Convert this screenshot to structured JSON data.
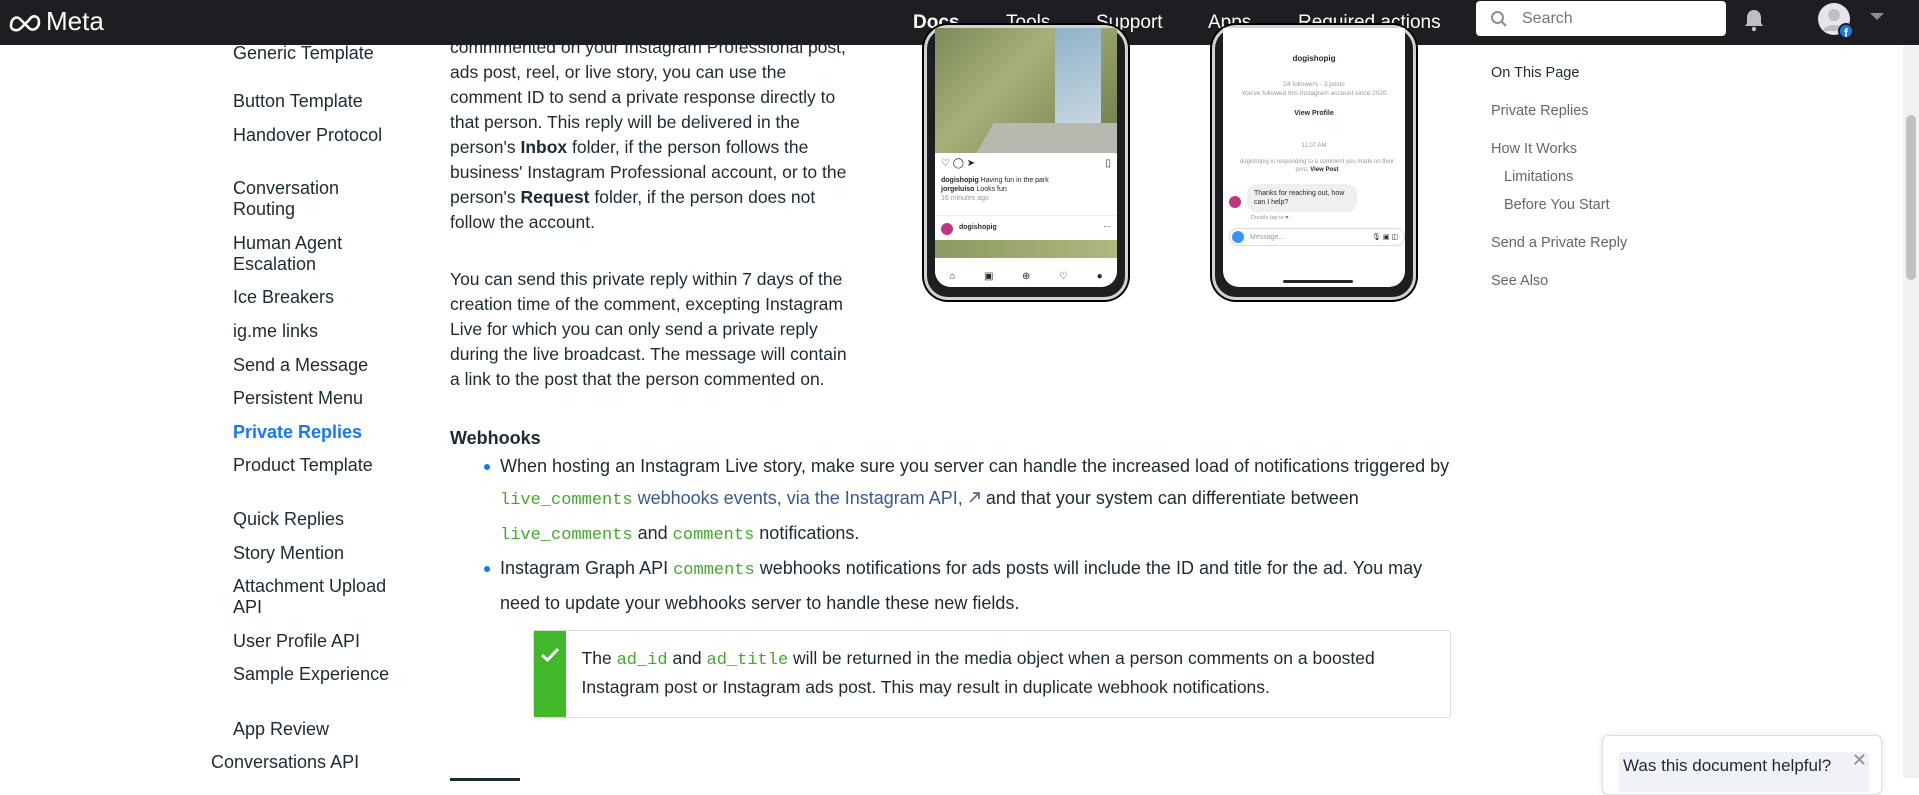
{
  "topbar": {
    "logo_text": "Meta",
    "nav": [
      "Docs",
      "Tools",
      "Support",
      "Apps",
      "Required actions"
    ],
    "search_placeholder": "Search"
  },
  "sidebar": {
    "items": [
      {
        "label": "Generic Template",
        "active": false
      },
      {
        "label": "Button Template",
        "active": false
      },
      {
        "label": "Handover Protocol",
        "active": false
      },
      {
        "label": "Conversation Routing",
        "active": false
      },
      {
        "label": "Human Agent Escalation",
        "active": false
      },
      {
        "label": "Ice Breakers",
        "active": false
      },
      {
        "label": "ig.me links",
        "active": false
      },
      {
        "label": "Send a Message",
        "active": false
      },
      {
        "label": "Persistent Menu",
        "active": false
      },
      {
        "label": "Private Replies",
        "active": true
      },
      {
        "label": "Product Template",
        "active": false
      },
      {
        "label": "Quick Replies",
        "active": false
      },
      {
        "label": "Story Mention",
        "active": false
      },
      {
        "label": "Attachment Upload API",
        "active": false
      },
      {
        "label": "User Profile API",
        "active": false
      },
      {
        "label": "Sample Experience",
        "active": false
      },
      {
        "label": "App Review",
        "active": false
      }
    ],
    "bottom_item": "Conversations API"
  },
  "content": {
    "para1": {
      "lead": "commmented on your Instagram Professional post, ads post, reel, or live story, you can use the comment ID to send a private response directly to that person. This reply will be delivered in the person's ",
      "inbox": "Inbox",
      "mid": " folder, if the person follows the business' Instagram Professional account, or to the person's ",
      "request": "Request",
      "tail": " folder, if the person does not follow the account."
    },
    "para2": "You can send this private reply within 7 days of the creation time of the comment, excepting Instagram Live for which you can only send a private reply during the live broadcast. The message will contain a link to the post that the person commented on.",
    "webhooks_heading": "Webhooks",
    "bullet1": {
      "a": "When hosting an Instagram Live story, make sure you server can handle the increased load of notifications triggered by ",
      "code1": "live_comments",
      "link": " webhooks events, via the Instagram API,",
      "b": " and that your system can differentiate between ",
      "code2": "live_comments",
      "c": " and ",
      "code3": "comments",
      "d": " notifications."
    },
    "bullet2": {
      "a": "Instagram Graph API ",
      "code": "comments",
      "b": " webhooks notifications for ads posts will include the ID and title for the ad. You may need to update your webhooks server to handle these new fields."
    },
    "callout": {
      "a": "The ",
      "code1": "ad_id",
      "b": " and ",
      "code2": "ad_title",
      "c": " will be returned in the media object when a person comments on a boosted Instagram post or Instagram ads post. This may result in duplicate webhook notifications."
    }
  },
  "phone_left": {
    "caption_user": "dogishopig",
    "caption_text": "Having fun in the park",
    "comment_user": "jorgeluiso",
    "comment_text": "Looks fun",
    "time": "16 minutes ago",
    "post_user": "dogishopig"
  },
  "phone_right": {
    "username": "dogishopig",
    "followers": "24 followers · 3 posts",
    "followed": "You've followed this Instagram account since 2020",
    "view_profile": "View Profile",
    "time": "11:07 AM",
    "notice": "dogishopig is responding to a comment you made on their post.",
    "notice_link": "View Post",
    "bubble": "Thanks for reaching out, how can I help?",
    "reply_hint": "Double tap to",
    "message_placeholder": "Message..."
  },
  "toc": {
    "title": "On This Page",
    "items": [
      "Private Replies",
      "How It Works",
      "Limitations",
      "Before You Start",
      "Send a Private Reply",
      "See Also"
    ]
  },
  "feedback": {
    "question": "Was this document helpful?"
  }
}
